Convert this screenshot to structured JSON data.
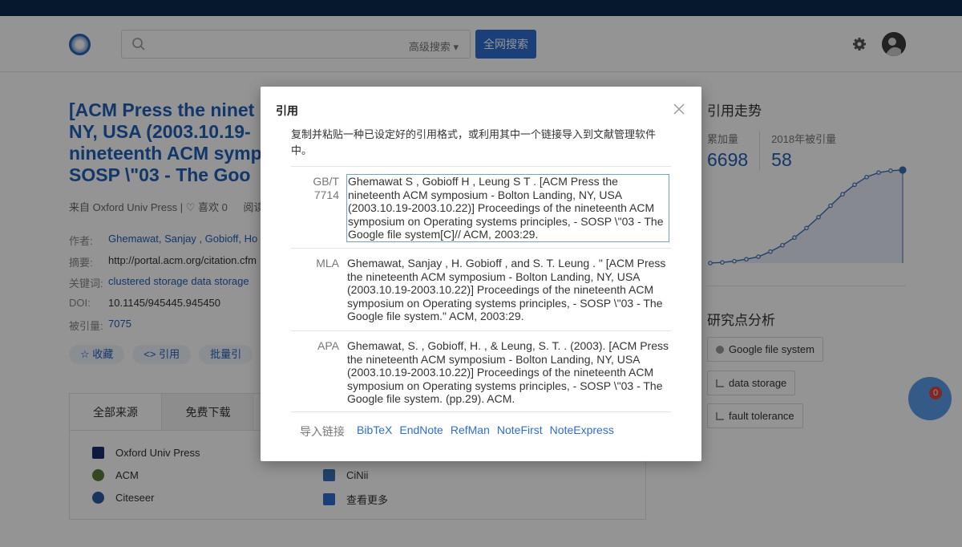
{
  "header": {
    "search_placeholder": "",
    "advanced_search": "高级搜索 ▾",
    "search_button": "全网搜索"
  },
  "paper": {
    "title_lines": [
      "[ACM Press the ninet",
      "NY, USA (2003.10.19-",
      "nineteenth ACM symp",
      "SOSP \\\"03 - The Goo"
    ],
    "source": "来自 Oxford Univ Press",
    "like": "♡ 喜欢 0",
    "read": "阅读",
    "fields": [
      {
        "label": "作者:",
        "value": "Ghemawat, Sanjay ,  Gobioff, Ho",
        "link": true
      },
      {
        "label": "摘要:",
        "value": "http://portal.acm.org/citation.cfm",
        "link": false
      },
      {
        "label": "关键词:",
        "value": "clustered storage   data storage",
        "link": true
      },
      {
        "label": "DOI:",
        "value": "10.1145/945445.945450",
        "link": false
      },
      {
        "label": "被引量:",
        "value": "7075",
        "link": true
      }
    ],
    "actions": [
      "☆  收藏",
      "<>  引用",
      "批量引"
    ]
  },
  "sources": {
    "tabs": [
      "全部来源",
      "免费下载"
    ],
    "items": [
      {
        "name": "Oxford Univ Press",
        "color": "#1a2f6b"
      },
      {
        "name": "ACM",
        "color": "#5a7a3a"
      },
      {
        "name": "Citeseer",
        "color": "#2c5aa0"
      },
      {
        "name": "CiNii",
        "color": "#3a6fb8"
      },
      {
        "name": "查看更多",
        "color": "#2e6dd1"
      }
    ]
  },
  "right": {
    "trend_title": "引用走势",
    "stat1_label": "累加量",
    "stat1_value": "6698",
    "stat2_label": "2018年被引量",
    "stat2_value": "58",
    "trend_values": [
      0,
      1,
      3,
      6,
      10,
      18,
      28,
      40,
      55,
      72,
      90,
      108,
      123,
      135,
      142,
      145,
      146
    ],
    "research_title": "研究点分析",
    "tags": [
      "Google file system",
      "data storage",
      "fault tolerance"
    ],
    "float_badge": "0"
  },
  "modal": {
    "title": "引用",
    "description": "复制并粘贴一种已设定好的引用格式，或利用其中一个链接导入到文献管理软件中。",
    "citations": [
      {
        "label_lines": [
          "GB/T",
          "7714"
        ],
        "lines": [
          "Ghemawat S , Gobioff H , Leung S T . [ACM Press the",
          "nineteenth ACM symposium - Bolton Landing, NY, USA",
          "(2003.10.19-2003.10.22)] Proceedings of the nineteenth ACM",
          "symposium on Operating systems principles, - SOSP \\\"03 - The",
          "Google file system[C]// ACM, 2003:29."
        ]
      },
      {
        "label_lines": [
          "MLA"
        ],
        "lines": [
          "Ghemawat, Sanjay , H. Gobioff , and S. T. Leung . \" [ACM Press",
          "the nineteenth ACM symposium - Bolton Landing, NY, USA",
          "(2003.10.19-2003.10.22)] Proceedings of the nineteenth ACM",
          "symposium on Operating systems principles, - SOSP \\\"03 - The",
          "Google file system.\" ACM, 2003:29."
        ]
      },
      {
        "label_lines": [
          "APA"
        ],
        "lines": [
          "Ghemawat, S. , Gobioff, H. , & Leung, S. T. . (2003). [ACM Press",
          "the nineteenth ACM symposium - Bolton Landing, NY, USA",
          "(2003.10.19-2003.10.22)] Proceedings of the nineteenth ACM",
          "symposium on Operating systems principles, - SOSP \\\"03 - The",
          "Google file system. (pp.29). ACM."
        ]
      }
    ],
    "import_label": "导入链接",
    "import_links": [
      "BibTeX",
      "EndNote",
      "RefMan",
      "NoteFirst",
      "NoteExpress"
    ]
  }
}
